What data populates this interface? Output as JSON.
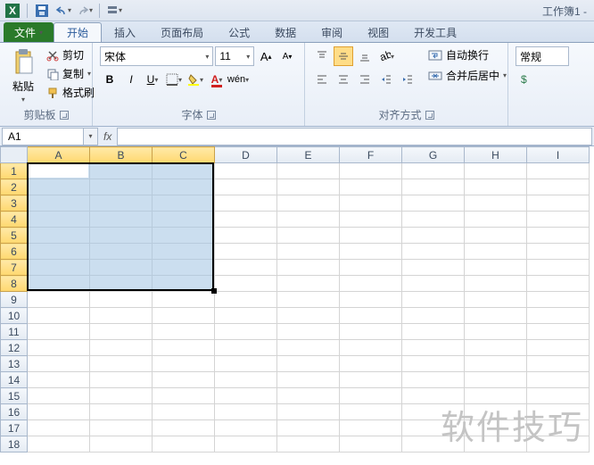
{
  "qat": {
    "doc_title": "工作簿1 -"
  },
  "tabs": {
    "file": "文件",
    "items": [
      "开始",
      "插入",
      "页面布局",
      "公式",
      "数据",
      "审阅",
      "视图",
      "开发工具"
    ],
    "active": 0
  },
  "clipboard": {
    "paste": "粘贴",
    "cut": "剪切",
    "copy": "复制",
    "format_painter": "格式刷",
    "group": "剪贴板"
  },
  "font": {
    "name": "宋体",
    "size": "11",
    "group": "字体"
  },
  "align": {
    "wrap": "自动换行",
    "merge": "合并后居中",
    "group": "对齐方式"
  },
  "number": {
    "format": "常规"
  },
  "namebox": {
    "ref": "A1",
    "fx": "fx"
  },
  "grid": {
    "cols": [
      "A",
      "B",
      "C",
      "D",
      "E",
      "F",
      "G",
      "H",
      "I"
    ],
    "rows": 18,
    "sel_cols": [
      0,
      1,
      2
    ],
    "sel_rows": [
      1,
      2,
      3,
      4,
      5,
      6,
      7,
      8
    ]
  },
  "watermark": "软件技巧"
}
